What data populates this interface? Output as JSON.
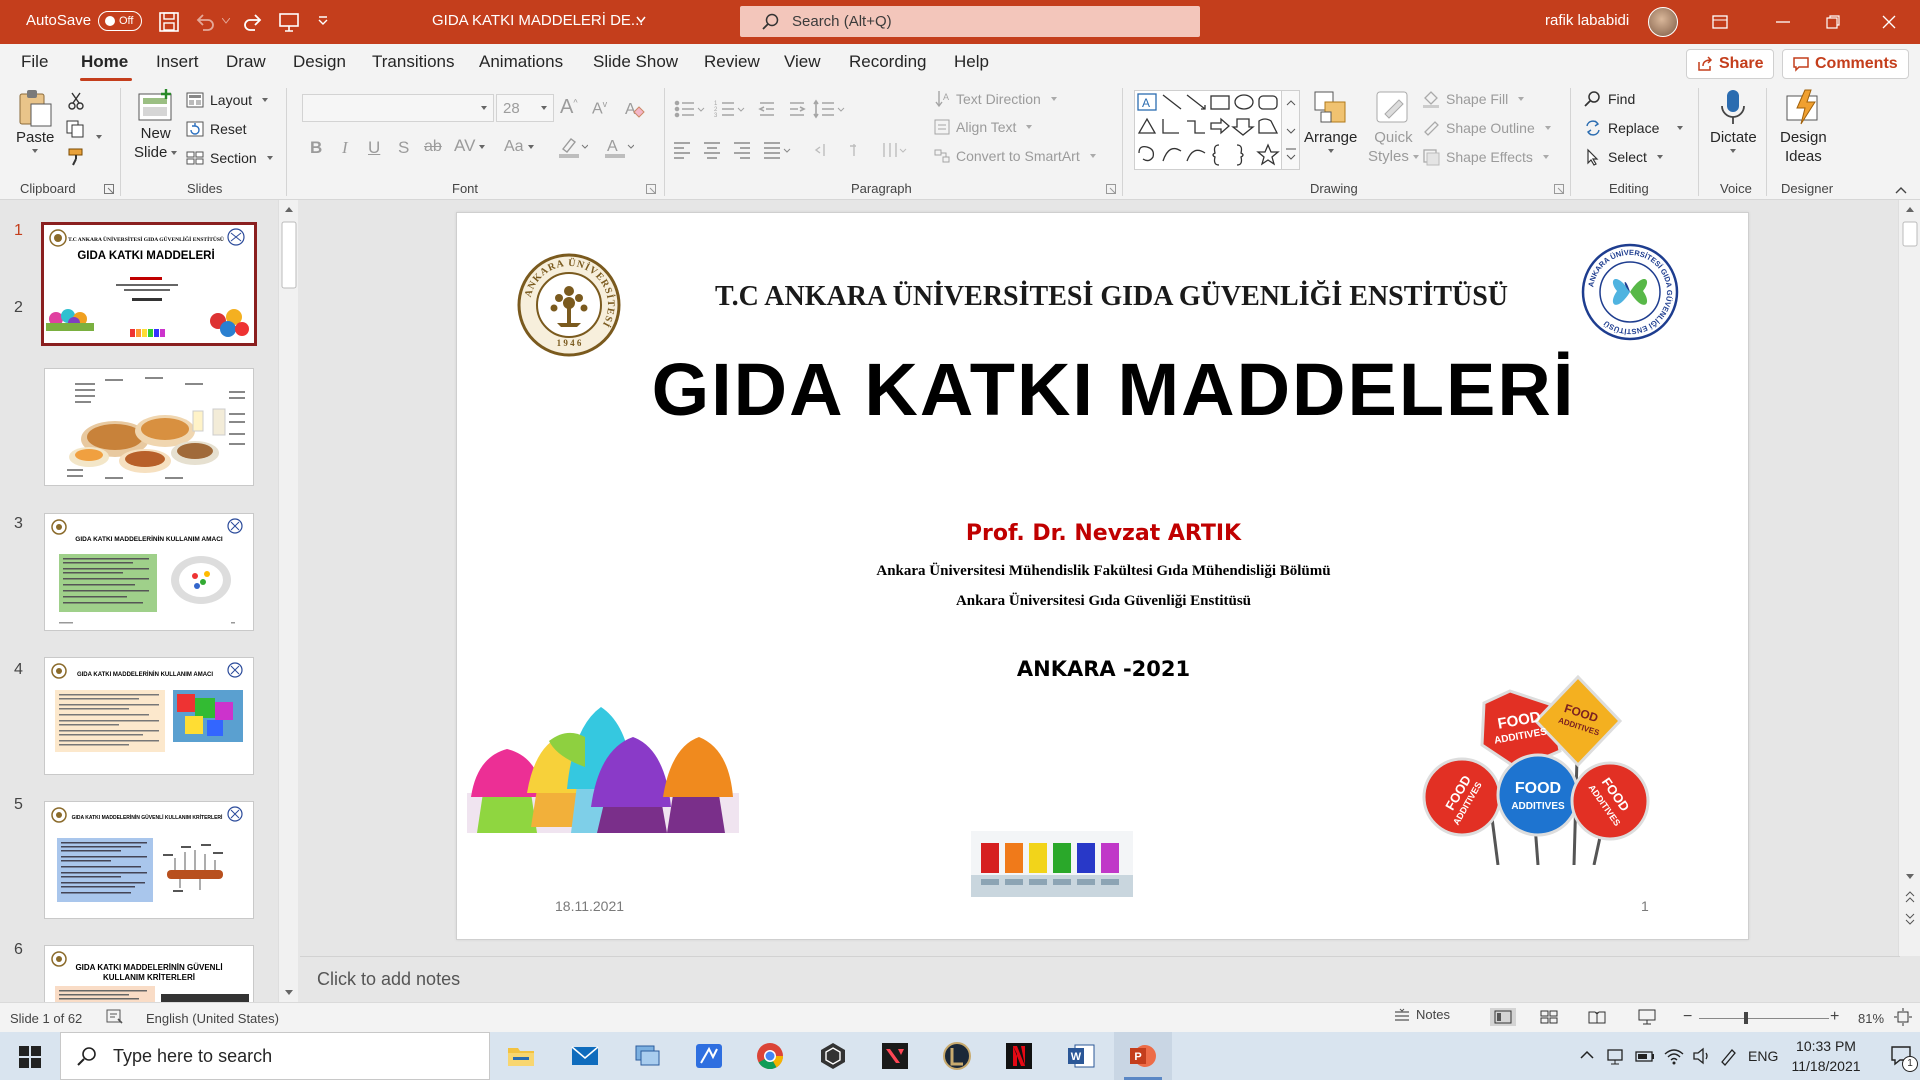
{
  "titlebar": {
    "autosave_label": "AutoSave",
    "autosave_state": "Off",
    "document_title": "GIDA KATKI MADDELERİ DE...",
    "search_placeholder": "Search (Alt+Q)",
    "user_name": "rafik lababidi"
  },
  "menu": {
    "tabs": [
      "File",
      "Home",
      "Insert",
      "Draw",
      "Design",
      "Transitions",
      "Animations",
      "Slide Show",
      "Review",
      "View",
      "Recording",
      "Help"
    ],
    "active_tab": "Home",
    "share_label": "Share",
    "comments_label": "Comments"
  },
  "ribbon": {
    "clipboard": {
      "paste": "Paste",
      "group": "Clipboard"
    },
    "slides": {
      "new_slide_1": "New",
      "new_slide_2": "Slide",
      "layout": "Layout",
      "reset": "Reset",
      "section": "Section",
      "group": "Slides"
    },
    "font": {
      "font_name": "",
      "font_size": "28",
      "group": "Font"
    },
    "paragraph": {
      "text_direction": "Text Direction",
      "align_text": "Align Text",
      "convert_smartart": "Convert to SmartArt",
      "group": "Paragraph"
    },
    "drawing": {
      "arrange": "Arrange",
      "quick_styles_1": "Quick",
      "quick_styles_2": "Styles",
      "shape_fill": "Shape Fill",
      "shape_outline": "Shape Outline",
      "shape_effects": "Shape Effects",
      "group": "Drawing"
    },
    "editing": {
      "find": "Find",
      "replace": "Replace",
      "select": "Select",
      "group": "Editing"
    },
    "voice": {
      "dictate": "Dictate",
      "group": "Voice"
    },
    "designer": {
      "design_ideas_1": "Design",
      "design_ideas_2": "Ideas",
      "group": "Designer"
    }
  },
  "thumbnails": {
    "numbers": [
      "1",
      "2",
      "3",
      "4",
      "5",
      "6"
    ],
    "t1_header": "T.C ANKARA ÜNİVERSİTESİ GIDA GÜVENLİĞİ ENSTİTÜSÜ",
    "t1_title": "GIDA KATKI MADDELERİ",
    "t3_title": "GIDA KATKI MADDELERİNİN KULLANIM AMACI",
    "t4_title": "GIDA KATKI MADDELERİNİN KULLANIM AMACI",
    "t5_title": "GIDA KATKI MADDELERİNİN GÜVENLİ KULLANIM KRİTERLERİ",
    "t6_title_1": "GIDA KATKI MADDELERİNİN GÜVENLİ",
    "t6_title_2": "KULLANIM KRİTERLERİ"
  },
  "slide": {
    "institute": "T.C ANKARA ÜNİVERSİTESİ GIDA GÜVENLİĞİ ENSTİTÜSÜ",
    "title": "GIDA KATKI MADDELERİ",
    "author": "Prof. Dr. Nevzat ARTIK",
    "affiliation_1": "Ankara Üniversitesi Mühendislik Fakültesi  Gıda Mühendisliği Bölümü",
    "affiliation_2": "Ankara Üniversitesi Gıda Güvenliği Enstitüsü",
    "place_year": "ANKARA -2021",
    "date": "18.11.2021",
    "page_number": "1",
    "logo_left_ring": "ANKARA ÜNİVERSİTESİ",
    "logo_left_year": "1 9 4 6",
    "logo_right_ring": "ANKARA ÜNİVERSİTESİ GIDA GÜVENLİĞİ ENSTİTÜSÜ",
    "sign_text_1": "FOOD",
    "sign_text_2": "ADDITIVES"
  },
  "notes": {
    "placeholder": "Click to add notes"
  },
  "status": {
    "slide_count": "Slide 1 of 62",
    "language": "English (United States)",
    "notes_label": "Notes",
    "zoom": "81%"
  },
  "taskbar": {
    "search_placeholder": "Type here to search",
    "lang": "ENG",
    "time": "10:33 PM",
    "date": "11/18/2021",
    "notification_count": "1"
  },
  "colors": {
    "accent": "#c43e1c",
    "author_red": "#c00000",
    "logo_brown": "#7a5a1e",
    "logo_blue": "#1e3d8f"
  }
}
